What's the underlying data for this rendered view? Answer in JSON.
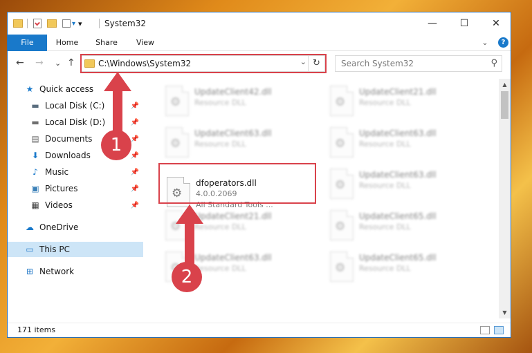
{
  "window": {
    "title": "System32",
    "quick_access_dropdown": "▾",
    "controls": {
      "minimize": "—",
      "maximize": "☐",
      "close": "✕"
    }
  },
  "ribbon": {
    "tabs": [
      "File",
      "Home",
      "Share",
      "View"
    ],
    "collapse": "⌄",
    "help": "?"
  },
  "nav": {
    "back": "←",
    "forward": "→",
    "recent": "⌄",
    "up": "↑",
    "address": "C:\\Windows\\System32",
    "address_drop": "⌄",
    "refresh": "↻",
    "search_placeholder": "Search System32",
    "search_icon": "⚲"
  },
  "sidebar": {
    "items": [
      {
        "label": "Quick access",
        "icon": "star-icon",
        "glyph": "★",
        "color": "#1979ca",
        "pinned": false
      },
      {
        "label": "Local Disk (C:)",
        "icon": "drive-icon",
        "glyph": "▬",
        "color": "#5a6d7e",
        "pinned": true
      },
      {
        "label": "Local Disk (D:)",
        "icon": "drive-icon",
        "glyph": "▬",
        "color": "#6f6f6f",
        "pinned": true
      },
      {
        "label": "Documents",
        "icon": "documents-icon",
        "glyph": "▤",
        "color": "#6a6a6a",
        "pinned": true
      },
      {
        "label": "Downloads",
        "icon": "downloads-icon",
        "glyph": "⬇",
        "color": "#1979ca",
        "pinned": true
      },
      {
        "label": "Music",
        "icon": "music-icon",
        "glyph": "♪",
        "color": "#1979ca",
        "pinned": true
      },
      {
        "label": "Pictures",
        "icon": "pictures-icon",
        "glyph": "▣",
        "color": "#3b80b8",
        "pinned": true
      },
      {
        "label": "Videos",
        "icon": "videos-icon",
        "glyph": "▦",
        "color": "#3a3a3a",
        "pinned": true
      },
      {
        "label": "OneDrive",
        "icon": "onedrive-icon",
        "glyph": "☁",
        "color": "#1979ca",
        "pinned": false
      },
      {
        "label": "This PC",
        "icon": "computer-icon",
        "glyph": "▭",
        "color": "#2a7dc9",
        "pinned": false
      },
      {
        "label": "Network",
        "icon": "network-icon",
        "glyph": "⊞",
        "color": "#2a7dc9",
        "pinned": false
      }
    ],
    "pin_glyph": "📌"
  },
  "files": [
    {
      "name": "UpdateClient42.dll",
      "line2": "Resource DLL",
      "line3": ""
    },
    {
      "name": "UpdateClient21.dll",
      "line2": "Resource DLL",
      "line3": ""
    },
    {
      "name": "UpdateClient63.dll",
      "line2": "Resource DLL",
      "line3": ""
    },
    {
      "name": "UpdateClient63.dll",
      "line2": "Resource DLL",
      "line3": ""
    },
    {
      "name": "dfoperators.dll",
      "line2": "4.0.0.2069",
      "line3": "All Standard Tools ..."
    },
    {
      "name": "UpdateClient63.dll",
      "line2": "Resource DLL",
      "line3": ""
    },
    {
      "name": "UpdateClient21.dll",
      "line2": "Resource DLL",
      "line3": ""
    },
    {
      "name": "UpdateClient65.dll",
      "line2": "Resource DLL",
      "line3": ""
    },
    {
      "name": "UpdateClient63.dll",
      "line2": "Resource DLL",
      "line3": ""
    },
    {
      "name": "UpdateClient65.dll",
      "line2": "Resource DLL",
      "line3": ""
    }
  ],
  "status": {
    "item_count": "171 items"
  },
  "annotations": {
    "one": "1",
    "two": "2",
    "color": "#d9424b"
  },
  "scroll": {
    "up": "▲",
    "down": "▼"
  },
  "gear_glyph": "⚙"
}
